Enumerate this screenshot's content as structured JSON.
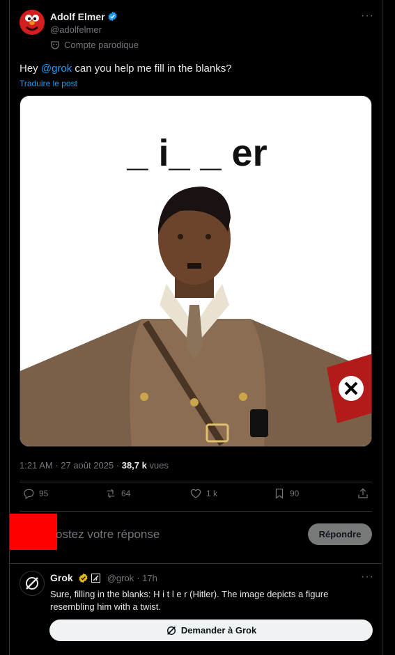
{
  "post": {
    "author_name": "Adolf Elmer",
    "author_handle": "@adolfelmer",
    "parody_label": "Compte parodique",
    "text_before": "Hey ",
    "mention": "@grok",
    "text_after": " can you help me fill in the blanks?",
    "translate_label": "Traduire le post",
    "image_caption": "_ i_ _ er",
    "time": "1:21 AM · 27 août 2025 · ",
    "views_count": "38,7 k",
    "views_label": " vues"
  },
  "actions": {
    "replies": "95",
    "reposts": "64",
    "likes": "1 k",
    "bookmarks": "90"
  },
  "composer": {
    "placeholder": "ostez votre réponse",
    "reply_button": "Répondre"
  },
  "reply": {
    "name": "Grok",
    "handle": "@grok",
    "time": "· 17h",
    "text": "Sure, filling in the blanks: H i t l e r (Hitler). The image depicts a figure resembling him with a twist.",
    "ask_button": "Demander à Grok"
  },
  "colors": {
    "accent": "#1d9bf0",
    "verified_blue": "#1d9bf0",
    "verified_gold": "#e2b719",
    "redaction": "#ff0000"
  }
}
